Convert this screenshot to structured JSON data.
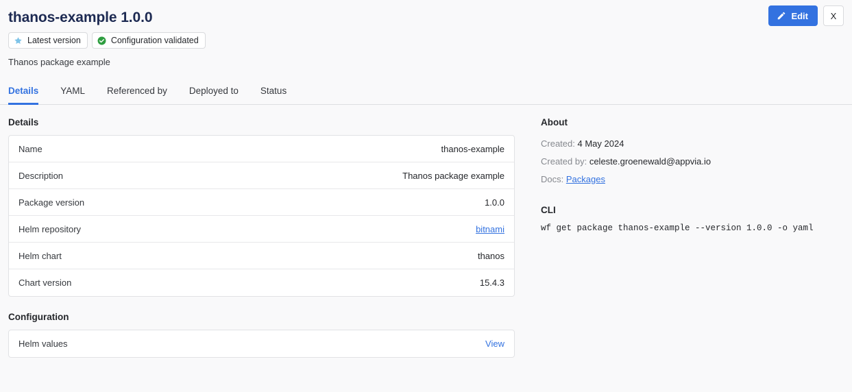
{
  "header": {
    "title": "thanos-example 1.0.0",
    "subtitle": "Thanos package example",
    "badges": [
      {
        "label": "Latest version",
        "icon": "star-icon",
        "color": "#7ec3e8"
      },
      {
        "label": "Configuration validated",
        "icon": "check-circle-icon",
        "color": "#2f9e41"
      }
    ],
    "edit_label": "Edit",
    "edit_icon": "pencil-icon",
    "close_label": "X",
    "close_icon": "close-icon",
    "accent_color": "#3372e0",
    "title_color": "#1d2a52"
  },
  "tabs": [
    {
      "label": "Details",
      "active": true
    },
    {
      "label": "YAML",
      "active": false
    },
    {
      "label": "Referenced by",
      "active": false
    },
    {
      "label": "Deployed to",
      "active": false
    },
    {
      "label": "Status",
      "active": false
    }
  ],
  "details": {
    "heading": "Details",
    "rows": [
      {
        "key": "Name",
        "value": "thanos-example",
        "link": false
      },
      {
        "key": "Description",
        "value": "Thanos package example",
        "link": false
      },
      {
        "key": "Package version",
        "value": "1.0.0",
        "link": false
      },
      {
        "key": "Helm repository",
        "value": "bitnami",
        "link": true
      },
      {
        "key": "Helm chart",
        "value": "thanos",
        "link": false
      },
      {
        "key": "Chart version",
        "value": "15.4.3",
        "link": false
      }
    ]
  },
  "configuration": {
    "heading": "Configuration",
    "rows": [
      {
        "key": "Helm values",
        "action": "View"
      }
    ]
  },
  "about": {
    "heading": "About",
    "created_label": "Created:",
    "created_value": "4 May 2024",
    "created_by_label": "Created by:",
    "created_by_value": "celeste.groenewald@appvia.io",
    "docs_label": "Docs:",
    "docs_link": "Packages"
  },
  "cli": {
    "heading": "CLI",
    "command": "wf get package thanos-example --version 1.0.0 -o yaml"
  }
}
